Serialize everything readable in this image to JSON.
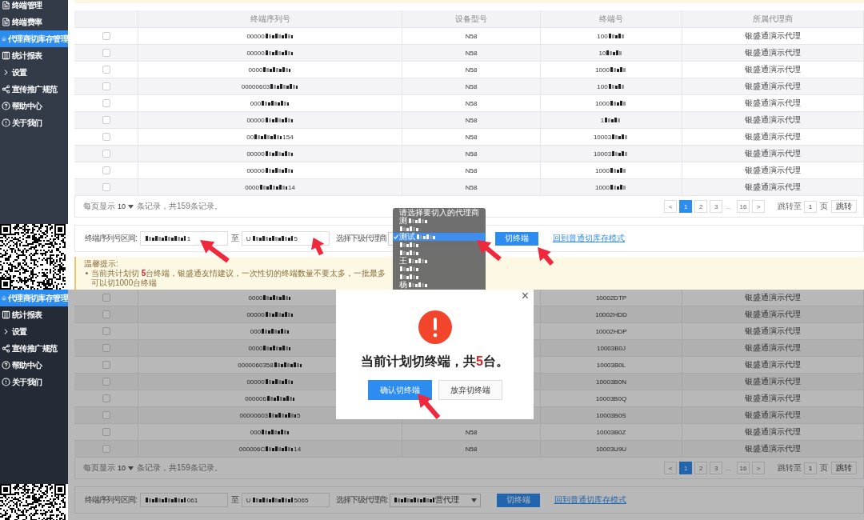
{
  "top": {
    "sidebar": [
      {
        "label": "终端管理",
        "selected": false
      },
      {
        "label": "终端费率",
        "selected": false
      },
      {
        "label": "代理商切库存管理",
        "selected": true
      },
      {
        "label": "统计报表",
        "selected": false
      },
      {
        "label": "设置",
        "selected": false
      },
      {
        "label": "宣传推广规范",
        "selected": false
      },
      {
        "label": "帮助中心",
        "selected": false
      },
      {
        "label": "关于我们",
        "selected": false
      }
    ],
    "table": {
      "columns": [
        "终端序列号",
        "设备型号",
        "终端号",
        "所属代理商"
      ],
      "rows": [
        {
          "checked": false,
          "serial": "00000",
          "serial_masked": true,
          "model": "N58",
          "terminal": "100",
          "terminal_masked": true,
          "agent": "银盛通演示代理"
        },
        {
          "checked": false,
          "serial": "00000",
          "serial_masked": true,
          "model": "N58",
          "terminal": "10",
          "terminal_masked": true,
          "agent": "银盛通演示代理"
        },
        {
          "checked": false,
          "serial": "0000",
          "serial_masked": true,
          "model": "N58",
          "terminal": "1000",
          "terminal_masked": true,
          "agent": "银盛通演示代理"
        },
        {
          "checked": false,
          "serial": "00000603",
          "serial_masked": true,
          "model": "N58",
          "terminal": "100",
          "terminal_masked": true,
          "agent": "银盛通演示代理"
        },
        {
          "checked": false,
          "serial": "000",
          "serial_masked": true,
          "model": "N58",
          "terminal": "1000",
          "terminal_masked": true,
          "agent": "银盛通演示代理"
        },
        {
          "checked": false,
          "serial": "00000",
          "serial_masked": true,
          "model": "N58",
          "terminal": "1",
          "terminal_masked": true,
          "agent": "银盛通演示代理"
        },
        {
          "checked": false,
          "serial": "00",
          "serial_masked": true,
          "serial_end": "154",
          "model": "N58",
          "terminal": "10003",
          "terminal_masked": true,
          "agent": "银盛通演示代理"
        },
        {
          "checked": false,
          "serial": "00000",
          "serial_masked": true,
          "model": "N58",
          "terminal": "10003",
          "terminal_masked": true,
          "agent": "银盛通演示代理"
        },
        {
          "checked": false,
          "serial": "00000",
          "serial_masked": true,
          "model": "N58",
          "terminal": "1000",
          "terminal_masked": true,
          "agent": "银盛通演示代理"
        },
        {
          "checked": false,
          "serial": "0000",
          "serial_masked": true,
          "serial_end": "14",
          "model": "N58",
          "terminal": "1000",
          "terminal_masked": true,
          "agent": "银盛通演示代理"
        }
      ]
    },
    "pagination": {
      "page_size_label": "每页显示",
      "page_size": "10",
      "summary": "条记录，共159条记录。",
      "prev": "<",
      "pages": [
        {
          "label": "1",
          "selected": true
        },
        {
          "label": "2",
          "selected": false
        },
        {
          "label": "3",
          "selected": false
        },
        {
          "label": "16",
          "selected": false
        }
      ],
      "ellipsis": "...",
      "next": ">",
      "jump_label": "跳转至",
      "jump_value": "1",
      "page_unit": "页",
      "jump_button": "跳转"
    },
    "filter": {
      "range_label": "终端序列号区间:",
      "from": {
        "masked": true,
        "suffix": "1"
      },
      "to_label": "至",
      "to": {
        "prefix": "U",
        "masked": true,
        "suffix": "5"
      },
      "agent_label": "选择下级代理商",
      "switch_button": "切终端",
      "link": "回到普通切库存模式"
    },
    "dropdown": {
      "options": [
        {
          "label": "请选择要切入的代理商",
          "masked": false,
          "selected": false
        },
        {
          "label": "测",
          "masked": true,
          "selected": false
        },
        {
          "masked": true,
          "selected": false
        },
        {
          "label": "测试",
          "masked": true,
          "selected": true
        },
        {
          "masked": true,
          "selected": false
        },
        {
          "masked": true,
          "selected": false
        },
        {
          "label": "王",
          "masked": true,
          "selected": false
        },
        {
          "masked": true,
          "selected": false
        },
        {
          "masked": true,
          "selected": false
        },
        {
          "label": "杨",
          "masked": true,
          "selected": false
        }
      ]
    },
    "tip": {
      "title": "温馨提示:",
      "text": "当前共计划切 **5**台终端，银盛通友情建议，一次性切的终端数量不要太多，一批最多可以切1000台终端"
    }
  },
  "bottom": {
    "sidebar": [
      {
        "label": "代理商切库存管理",
        "selected": true
      },
      {
        "label": "统计报表",
        "selected": false
      },
      {
        "label": "设置",
        "selected": false
      },
      {
        "label": "宣传推广规范",
        "selected": false
      },
      {
        "label": "帮助中心",
        "selected": false
      },
      {
        "label": "关于我们",
        "selected": false
      }
    ],
    "table": {
      "rows": [
        {
          "checked": false,
          "serial": "0000",
          "serial_masked": true,
          "terminal": "10002DTP",
          "terminal_masked": false,
          "agent": "银盛通演示代理"
        },
        {
          "checked": false,
          "serial": "00000",
          "serial_masked": true,
          "terminal": "10002HDD",
          "terminal_masked": false,
          "agent": "银盛通演示代理"
        },
        {
          "checked": false,
          "serial": "000",
          "serial_masked": true,
          "terminal": "10002HDP",
          "terminal_masked": false,
          "agent": "银盛通演示代理"
        },
        {
          "checked": false,
          "serial": "0000",
          "serial_masked": true,
          "terminal": "10003B0J",
          "terminal_masked": false,
          "agent": "银盛通演示代理"
        },
        {
          "checked": false,
          "serial": "0000060358",
          "serial_masked": true,
          "terminal": "10003B0L",
          "terminal_masked": false,
          "agent": "银盛通演示代理"
        },
        {
          "checked": false,
          "serial": "00000",
          "serial_masked": true,
          "terminal": "10003B0N",
          "terminal_masked": false,
          "agent": "银盛通演示代理"
        },
        {
          "checked": false,
          "serial": "000006",
          "serial_masked": true,
          "terminal": "10003B0Q",
          "terminal_masked": false,
          "agent": "银盛通演示代理"
        },
        {
          "checked": false,
          "serial": "00000603",
          "serial_masked": true,
          "serial_end": "5",
          "terminal": "10003B0S",
          "terminal_masked": false,
          "agent": "银盛通演示代理"
        },
        {
          "checked": false,
          "serial": "000",
          "serial_masked": true,
          "model": "N58",
          "terminal": "10003B0Z",
          "terminal_masked": false,
          "agent": "银盛通演示代理"
        },
        {
          "checked": false,
          "serial": "000006C",
          "serial_masked": true,
          "serial_end": "14",
          "model": "N58",
          "terminal": "10003U9U",
          "terminal_masked": false,
          "agent": "银盛通演示代理"
        }
      ]
    },
    "pagination": {
      "page_size_label": "每页显示",
      "page_size": "10",
      "summary": "条记录，共159条记录。",
      "prev": "<",
      "pages": [
        {
          "label": "1",
          "selected": true
        },
        {
          "label": "2",
          "selected": false
        },
        {
          "label": "3",
          "selected": false
        },
        {
          "label": "16",
          "selected": false
        }
      ],
      "ellipsis": "...",
      "next": ">",
      "jump_label": "跳转至",
      "jump_value": "1",
      "page_unit": "页",
      "jump_button": "跳转"
    },
    "filter": {
      "range_label": "终端序列号区间:",
      "from": {
        "masked": true,
        "suffix": "061"
      },
      "to_label": "至",
      "to": {
        "prefix": "U",
        "masked": true,
        "suffix": "5065"
      },
      "agent_label": "选择下级代理商:",
      "agent_value": {
        "masked": true,
        "suffix": "营代理"
      },
      "switch_button": "切终端",
      "link": "回到普通切库存模式"
    },
    "dialog": {
      "close": "×",
      "message": "当前计划切终端，共**5**台。",
      "confirm": "确认切终端",
      "cancel": "放弃切终端"
    }
  }
}
